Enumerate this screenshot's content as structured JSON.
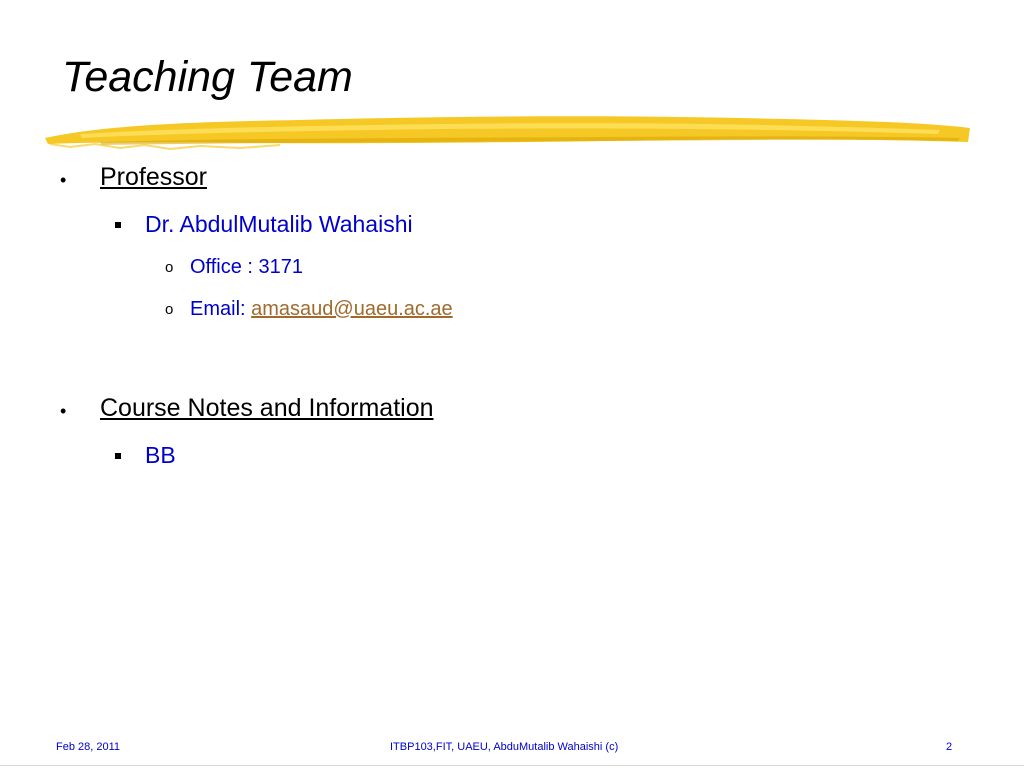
{
  "slide": {
    "title": "Teaching Team",
    "accent_color": "#f4c20d",
    "sections": [
      {
        "label": "Professor",
        "sub": {
          "name": "Dr. AbdulMutalib Wahaishi",
          "details": [
            {
              "text": "Office : 3171"
            },
            {
              "prefix": "Email: ",
              "link_text": "amasaud@uaeu.ac.ae"
            }
          ]
        }
      },
      {
        "label": "Course Notes and Information",
        "sub": {
          "name": "BB"
        }
      }
    ],
    "bullets": {
      "level1": "•",
      "level3": "o"
    }
  },
  "footer": {
    "date": "Feb 28, 2011",
    "center": "ITBP103,FIT, UAEU, AbduMutalib Wahaishi (c)",
    "page_number": "2"
  }
}
